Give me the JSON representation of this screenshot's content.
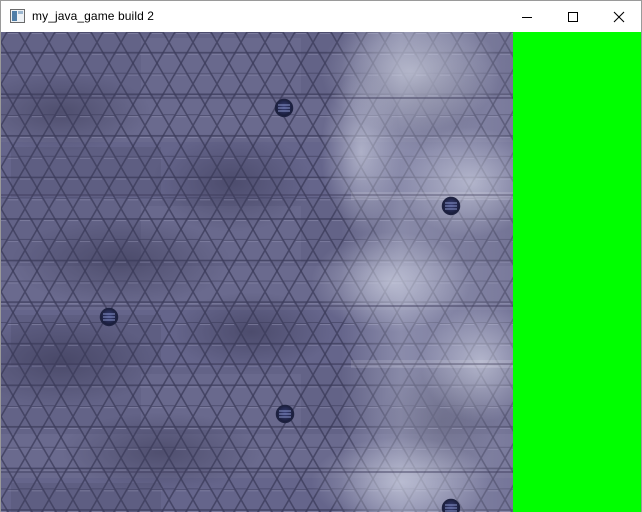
{
  "window": {
    "title": "my_java_game build 2",
    "controls": [
      "minimize-icon",
      "maximize-icon",
      "close-icon"
    ]
  },
  "game": {
    "floor_tile_color": "#6a6a8c",
    "floor_shadow_color": "#4e4d70",
    "fog_color": "#d3d7e8",
    "vent_color": "#1e2240",
    "side_panel_color": "#00ff00"
  }
}
